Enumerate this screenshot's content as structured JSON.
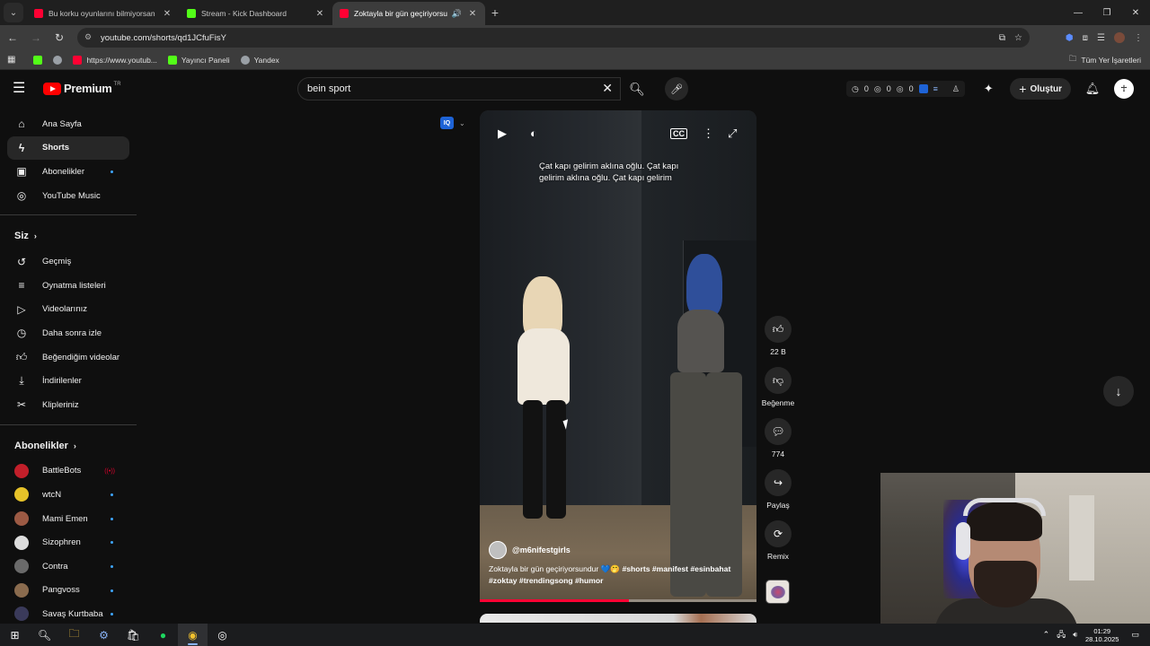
{
  "browser": {
    "tabs": [
      {
        "title": "Bu korku oyunlarını bilmiyorsan",
        "favicon_color": "#ff0033",
        "active": false
      },
      {
        "title": "Stream - Kick Dashboard",
        "favicon_color": "#53fc18",
        "active": false
      },
      {
        "title": "Zoktayla bir gün geçiriyorsu",
        "favicon_color": "#ff0033",
        "active": true
      }
    ],
    "url": "youtube.com/shorts/qd1JCfuFisY",
    "bookmarks": [
      {
        "label": "",
        "icon": "kick-icon",
        "color": "#53fc18"
      },
      {
        "label": "",
        "icon": "globe-icon",
        "color": "#9aa0a6"
      },
      {
        "label": "https://www.youtub...",
        "icon": "youtube-icon",
        "color": "#ff0033"
      },
      {
        "label": "Yayıncı Paneli",
        "icon": "kick-icon",
        "color": "#53fc18"
      },
      {
        "label": "Yandex",
        "icon": "globe-icon",
        "color": "#9aa0a6"
      }
    ],
    "all_bookmarks": "Tüm Yer İşaretleri"
  },
  "youtube": {
    "logo_word": "Premium",
    "region": "TR",
    "search_value": "bein sport",
    "ext_stats": [
      "0",
      "0",
      "0"
    ],
    "create_label": "Oluştur"
  },
  "sidebar": {
    "main": [
      {
        "label": "Ana Sayfa",
        "icon": "home-icon",
        "active": false
      },
      {
        "label": "Shorts",
        "icon": "shorts-icon",
        "active": true
      },
      {
        "label": "Abonelikler",
        "icon": "subscriptions-icon",
        "active": false,
        "dot": true
      },
      {
        "label": "YouTube Music",
        "icon": "music-icon",
        "active": false
      }
    ],
    "you_header": "Siz",
    "you": [
      {
        "label": "Geçmiş",
        "icon": "history-icon"
      },
      {
        "label": "Oynatma listeleri",
        "icon": "playlists-icon"
      },
      {
        "label": "Videolarınız",
        "icon": "your-videos-icon"
      },
      {
        "label": "Daha sonra izle",
        "icon": "watch-later-icon"
      },
      {
        "label": "Beğendiğim videolar",
        "icon": "liked-icon"
      },
      {
        "label": "İndirilenler",
        "icon": "download-icon"
      },
      {
        "label": "Klipleriniz",
        "icon": "clips-icon"
      }
    ],
    "subs_header": "Abonelikler",
    "subs": [
      {
        "label": "BattleBots",
        "color": "#c21f2a",
        "live": true
      },
      {
        "label": "wtcN",
        "color": "#e6c229",
        "live": false
      },
      {
        "label": "Mami Emen",
        "color": "#9c5a44",
        "live": false
      },
      {
        "label": "Sizophren",
        "color": "#dddddd",
        "live": false
      },
      {
        "label": "Contra",
        "color": "#6a6a6a",
        "live": false
      },
      {
        "label": "Pangvoss",
        "color": "#8a6b4e",
        "live": false
      },
      {
        "label": "Savaş Kurtbaba",
        "color": "#3a3a5a",
        "live": false
      }
    ]
  },
  "short": {
    "caption": "Çat kapı gelirim aklına oğlu. Çat kapı gelirim aklına oğlu. Çat kapı gelirim",
    "channel": "@m6nifestgirls",
    "description_text": "Zoktayla bir gün geçiriyorsundur 💙🤭",
    "hashtags": "#shorts #manifest #esinbahat #zoktay #trendingsong #humor",
    "progress": 0.54
  },
  "actions": {
    "like_count": "22 B",
    "dislike_label": "Beğenme",
    "comment_count": "774",
    "share_label": "Paylaş",
    "remix_label": "Remix"
  },
  "taskbar": {
    "time": "01:29",
    "date": "28.10.2025"
  }
}
